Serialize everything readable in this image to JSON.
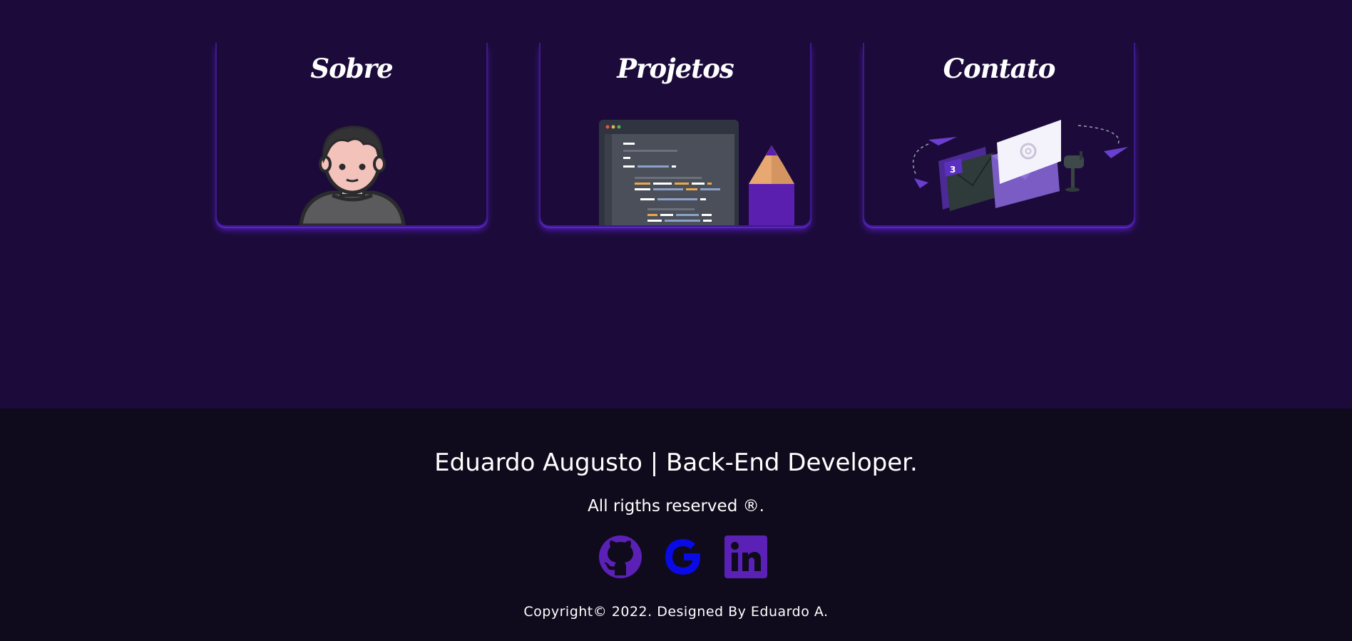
{
  "cards": [
    {
      "title": "Sobre",
      "illustration": "avatar-illustration"
    },
    {
      "title": "Projetos",
      "illustration": "code-editor-pencil-illustration"
    },
    {
      "title": "Contato",
      "illustration": "envelopes-mail-illustration"
    }
  ],
  "footer": {
    "title": "Eduardo Augusto | Back-End Developer.",
    "rights": "All rigths reserved ®.",
    "social": [
      {
        "name": "github-icon",
        "color": "#5b21b6"
      },
      {
        "name": "google-icon",
        "color": "#0a0ae6"
      },
      {
        "name": "linkedin-icon",
        "color": "#5b21b6"
      }
    ],
    "copyright": "Copyright© 2022. Designed By Eduardo A."
  },
  "colors": {
    "background": "#1c0b3a",
    "footer_background": "#0f0b1c",
    "accent": "#6a22d8"
  }
}
